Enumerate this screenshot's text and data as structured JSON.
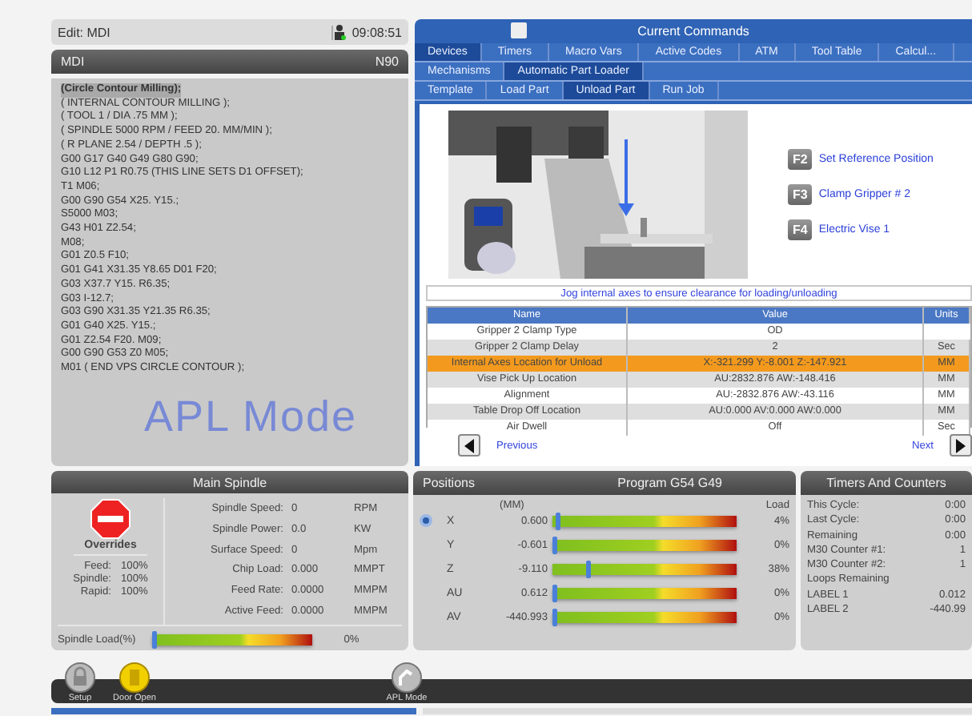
{
  "status_bar": {
    "mode": "Edit: MDI",
    "time": "09:08:51"
  },
  "program": {
    "title": "MDI",
    "line": "N90",
    "overlay": "APL Mode",
    "lines": [
      {
        "text": "(Circle Contour Milling);",
        "selected": true
      },
      {
        "text": "( INTERNAL CONTOUR MILLING );",
        "selected": false
      },
      {
        "text": "( TOOL 1 / DIA .75 MM );",
        "selected": false
      },
      {
        "text": "( SPINDLE 5000 RPM / FEED 20. MM/MIN );",
        "selected": false
      },
      {
        "text": "( R PLANE 2.54 / DEPTH .5 );",
        "selected": false
      },
      {
        "text": "G00 G17 G40 G49 G80 G90;",
        "selected": false
      },
      {
        "text": "G10 L12 P1 R0.75 (THIS LINE SETS D1 OFFSET);",
        "selected": false
      },
      {
        "text": "T1 M06;",
        "selected": false
      },
      {
        "text": "G00 G90 G54 X25. Y15.;",
        "selected": false
      },
      {
        "text": "S5000 M03;",
        "selected": false
      },
      {
        "text": "G43 H01 Z2.54;",
        "selected": false
      },
      {
        "text": "M08;",
        "selected": false
      },
      {
        "text": "G01 Z0.5 F10;",
        "selected": false
      },
      {
        "text": "G01 G41 X31.35 Y8.65 D01 F20;",
        "selected": false
      },
      {
        "text": "G03 X37.7 Y15. R6.35;",
        "selected": false
      },
      {
        "text": "G03 I-12.7;",
        "selected": false
      },
      {
        "text": "G03 G90 X31.35 Y21.35 R6.35;",
        "selected": false
      },
      {
        "text": "G01 G40 X25. Y15.;",
        "selected": false
      },
      {
        "text": "G01 Z2.54 F20. M09;",
        "selected": false
      },
      {
        "text": "G00 G90 G53 Z0 M05;",
        "selected": false
      },
      {
        "text": "M01 ( END VPS CIRCLE CONTOUR );",
        "selected": false
      }
    ]
  },
  "commands": {
    "title": "Current Commands",
    "tabs": [
      {
        "label": "Devices",
        "selected": true
      },
      {
        "label": "Timers",
        "selected": false
      },
      {
        "label": "Macro Vars",
        "selected": false
      },
      {
        "label": "Active Codes",
        "selected": false
      },
      {
        "label": "ATM",
        "selected": false
      },
      {
        "label": "Tool Table",
        "selected": false
      },
      {
        "label": "Calcul...",
        "selected": false
      }
    ],
    "subtabs": [
      {
        "label": "Mechanisms",
        "selected": false
      },
      {
        "label": "Automatic Part Loader",
        "selected": true
      }
    ],
    "steps": [
      {
        "label": "Template",
        "selected": false
      },
      {
        "label": "Load Part",
        "selected": false
      },
      {
        "label": "Unload Part",
        "selected": true
      },
      {
        "label": "Run Job",
        "selected": false
      }
    ],
    "actions": [
      {
        "key": "F2",
        "label": "Set Reference Position"
      },
      {
        "key": "F3",
        "label": "Clamp Gripper # 2"
      },
      {
        "key": "F4",
        "label": "Electric Vise 1"
      }
    ],
    "instruction": "Jog internal axes to ensure clearance for loading/unloading",
    "table": {
      "columns": [
        "Name",
        "Value",
        "Units"
      ],
      "rows": [
        {
          "name": "Gripper 2 Clamp Type",
          "value": "OD",
          "selected": false
        },
        {
          "name": "Gripper 2 Clamp Delay",
          "value": "2",
          "units": "Sec",
          "selected": false
        },
        {
          "name": "Internal Axes Location for Unload",
          "value": "X:-321.299 Y:-8.001 Z:-147.921",
          "units": "MM",
          "selected": true
        },
        {
          "name": "Vise Pick Up Location",
          "value": "AU:2832.876 AW:-148.416",
          "units": "MM",
          "selected": false
        },
        {
          "name": "Alignment",
          "value": "AU:-2832.876 AW:-43.116",
          "units": "MM",
          "selected": false
        },
        {
          "name": "Table Drop Off Location",
          "value": "AU:0.000 AV:0.000 AW:0.000",
          "units": "MM",
          "selected": false
        },
        {
          "name": "Air Dwell",
          "value": "Off",
          "units": "Sec",
          "selected": false
        }
      ]
    },
    "previous": "Previous",
    "next": "Next"
  },
  "spindle": {
    "title": "Main Spindle",
    "overrides_title": "Overrides",
    "overrides": [
      {
        "label": "Feed:",
        "value": "100%"
      },
      {
        "label": "Spindle:",
        "value": "100%"
      },
      {
        "label": "Rapid:",
        "value": "100%"
      }
    ],
    "readings": [
      {
        "label": "Spindle Speed:",
        "value": "0",
        "unit": "RPM"
      },
      {
        "label": "Spindle Power:",
        "value": "0.0",
        "unit": "KW"
      },
      {
        "label": "Surface Speed:",
        "value": "0",
        "unit": "Mpm"
      },
      {
        "label": "Chip Load:",
        "value": "0.000",
        "unit": "MMPT"
      },
      {
        "label": "Feed Rate:",
        "value": "0.0000",
        "unit": "MMPM"
      },
      {
        "label": "Active Feed:",
        "value": "0.0000",
        "unit": "MMPM"
      }
    ],
    "load": {
      "label": "Spindle Load(%)",
      "level": 0,
      "text": "0%"
    }
  },
  "positions": {
    "title": "Positions",
    "program": "Program G54 G49",
    "unit": "(MM)",
    "load_heading": "Load",
    "axes": [
      {
        "axis": "X",
        "value": "0.600",
        "level": 0.02,
        "load": "4%",
        "active": true
      },
      {
        "axis": "Y",
        "value": "-0.601",
        "level": 0,
        "load": "0%",
        "active": false
      },
      {
        "axis": "Z",
        "value": "-9.110",
        "level": 0.19,
        "load": "38%",
        "active": false
      },
      {
        "axis": "AU",
        "value": "0.612",
        "level": 0,
        "load": "0%",
        "active": false
      },
      {
        "axis": "AV",
        "value": "-440.993",
        "level": 0,
        "load": "0%",
        "active": false
      }
    ]
  },
  "timers": {
    "title": "Timers And Counters",
    "rows": [
      {
        "label": "This Cycle:",
        "value": "0:00"
      },
      {
        "label": "Last Cycle:",
        "value": "0:00"
      },
      {
        "label": "Remaining",
        "value": "0:00"
      },
      {
        "label": "M30 Counter #1:",
        "value": "1"
      },
      {
        "label": "M30 Counter #2:",
        "value": "1"
      },
      {
        "label": "Loops Remaining"
      },
      {
        "label": "LABEL 1",
        "value": "0.012"
      },
      {
        "label": "LABEL 2",
        "value": "-440.99"
      }
    ]
  },
  "toolbar": [
    {
      "kind": "lock",
      "label": "Setup"
    },
    {
      "kind": "door",
      "label": "Door Open"
    },
    {
      "kind": "apl",
      "label": "APL Mode"
    }
  ]
}
